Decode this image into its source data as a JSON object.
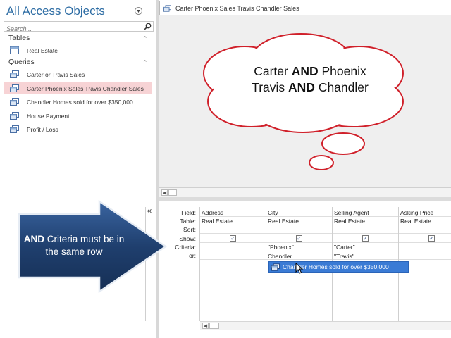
{
  "nav": {
    "title": "All Access Objects",
    "search_placeholder": "Search...",
    "groups": [
      {
        "label": "Tables",
        "items": [
          {
            "label": "Real Estate",
            "icon": "table-icon",
            "selected": false
          }
        ]
      },
      {
        "label": "Queries",
        "items": [
          {
            "label": "Carter or Travis Sales",
            "icon": "query-icon",
            "selected": false
          },
          {
            "label": "Carter Phoenix Sales Travis Chandler Sales",
            "icon": "query-icon",
            "selected": true
          },
          {
            "label": "Chandler Homes sold for over $350,000",
            "icon": "query-icon",
            "selected": false
          },
          {
            "label": "House Payment",
            "icon": "query-icon",
            "selected": false
          },
          {
            "label": "Profit / Loss",
            "icon": "query-icon",
            "selected": false
          }
        ]
      }
    ]
  },
  "tab": {
    "label": "Carter Phoenix Sales Travis Chandler Sales",
    "icon": "query-icon"
  },
  "cloud": {
    "line1_a": "Carter ",
    "line1_b": "AND",
    "line1_c": " Phoenix",
    "line2_a": "Travis ",
    "line2_b": "AND",
    "line2_c": " Chandler"
  },
  "callout": {
    "bold": "AND",
    "text": " Criteria must be in the same row"
  },
  "grid": {
    "row_labels": [
      "Field:",
      "Table:",
      "Sort:",
      "Show:",
      "Criteria:",
      "or:"
    ],
    "columns": [
      {
        "field": "Address",
        "table": "Real Estate",
        "sort": "",
        "show": true,
        "criteria": "",
        "or": ""
      },
      {
        "field": "City",
        "table": "Real Estate",
        "sort": "",
        "show": true,
        "criteria": "\"Phoenix\"",
        "or": "Chandler"
      },
      {
        "field": "Selling Agent",
        "table": "Real Estate",
        "sort": "",
        "show": true,
        "criteria": "\"Carter\"",
        "or": "\"Travis\""
      },
      {
        "field": "Asking Price",
        "table": "Real Estate",
        "sort": "",
        "show": true,
        "criteria": "",
        "or": ""
      }
    ],
    "drag_hint": "Chandler Homes sold for over $350,000"
  },
  "colors": {
    "nav_title": "#2e6da4",
    "selected_item": "#f7d3d5",
    "cloud_stroke": "#d0202a",
    "callout_fill": "#1f3f6e",
    "drag_hint_bg": "#3a7bd5"
  }
}
